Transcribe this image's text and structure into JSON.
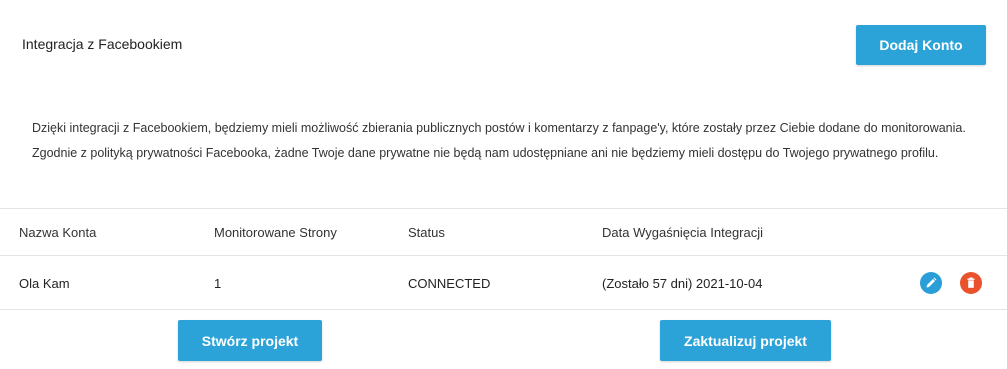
{
  "header": {
    "title": "Integracja z Facebookiem",
    "add_account_label": "Dodaj Konto"
  },
  "info": {
    "paragraph1": "Dzięki integracji z Facebookiem, będziemy mieli możliwość zbierania publicznych postów i komentarzy z fanpage'y, które zostały przez Ciebie dodane do monitorowania.",
    "paragraph2": "Zgodnie z polityką prywatności Facebooka, żadne Twoje dane prywatne nie będą nam udostępniane ani nie będziemy mieli dostępu do Twojego prywatnego profilu."
  },
  "table": {
    "columns": [
      "Nazwa Konta",
      "Monitorowane Strony",
      "Status",
      "Data Wygaśnięcia Integracji"
    ],
    "rows": [
      {
        "account_name": "Ola Kam",
        "monitored_pages": "1",
        "status": "CONNECTED",
        "expiry": "(Zostało 57 dni) 2021-10-04"
      }
    ],
    "row_actions": {
      "edit_icon": "pencil-icon",
      "delete_icon": "trash-icon"
    }
  },
  "footer": {
    "create_label": "Stwórz projekt",
    "update_label": "Zaktualizuj projekt"
  },
  "colors": {
    "primary": "#2ba3d8",
    "danger": "#e9522d"
  }
}
